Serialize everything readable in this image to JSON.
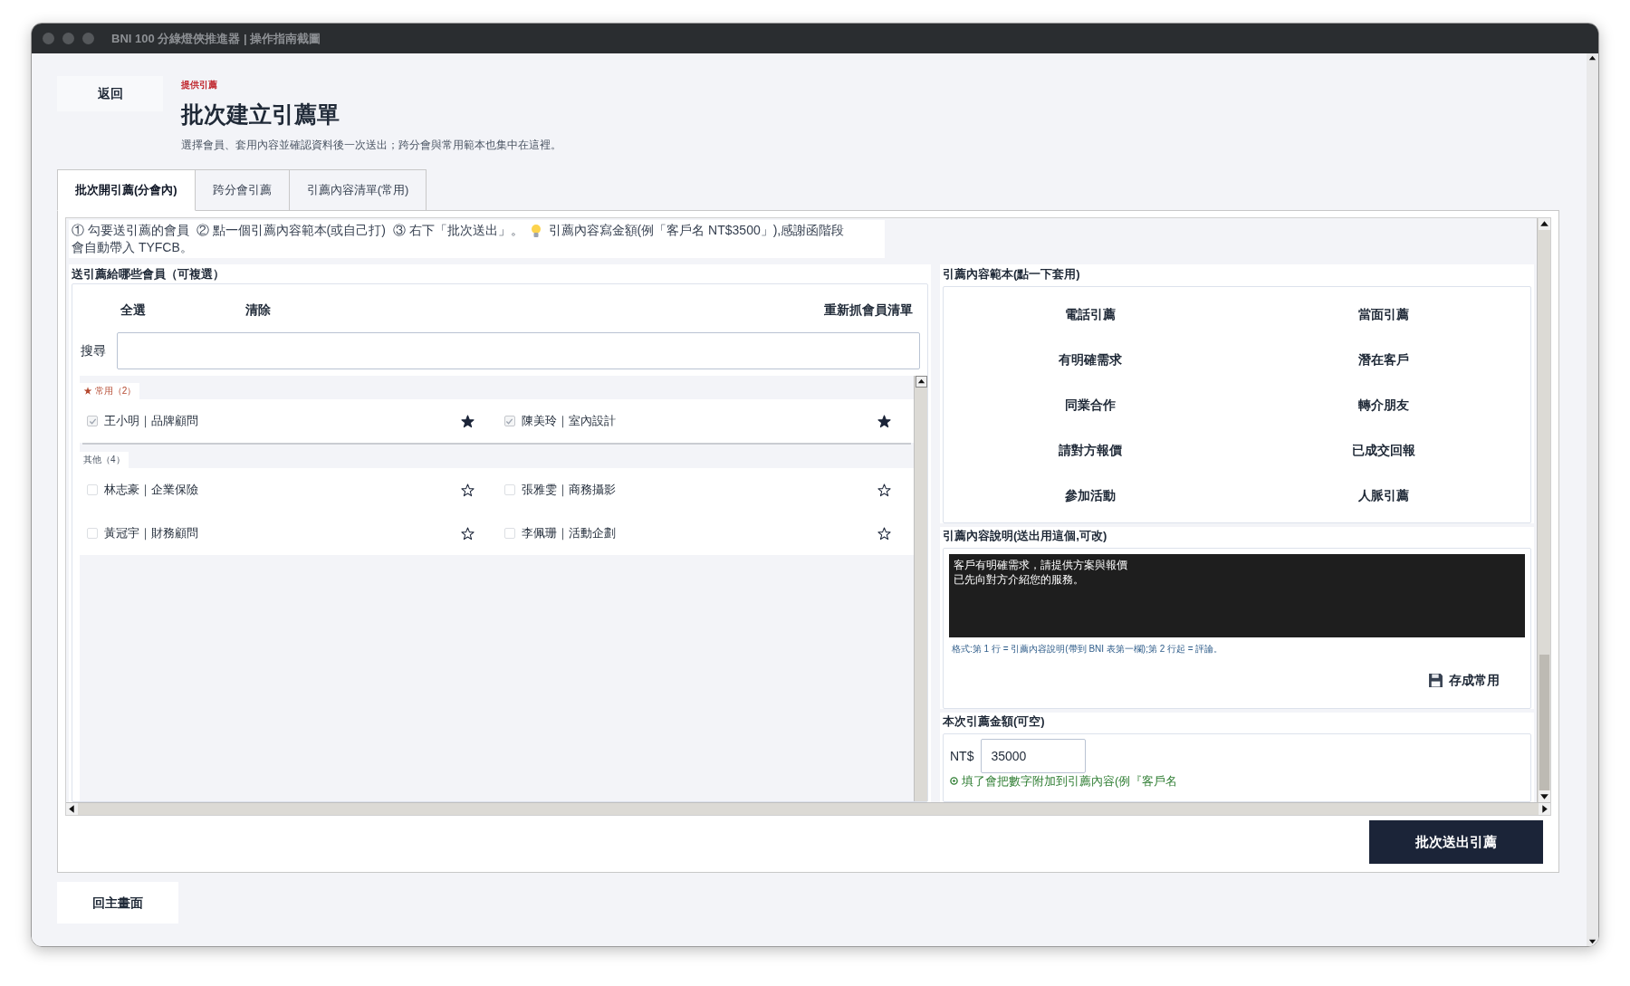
{
  "window": {
    "title": "BNI 100 分綠燈俠推進器 | 操作指南截圖"
  },
  "back_button": "返回",
  "header": {
    "eyebrow": "提供引薦",
    "title": "批次建立引薦單",
    "subtitle": "選擇會員、套用內容並確認資料後一次送出；跨分會與常用範本也集中在這裡。"
  },
  "tabs": [
    {
      "label": "批次開引薦(分會內)",
      "selected": true
    },
    {
      "label": "跨分會引薦",
      "selected": false
    },
    {
      "label": "引薦內容清單(常用)",
      "selected": false
    }
  ],
  "hint": {
    "steps": "① 勾要送引薦的會員  ② 點一個引薦內容範本(或自己打)  ③ 右下「批次送出」。",
    "tip_lines": [
      "引薦內容寫金額(例「客戶名 NT$3500」),感謝函階段",
      "會自動帶入 TYFCB。"
    ]
  },
  "members": {
    "label": "送引薦給哪些會員（可複選）",
    "actions": [
      "全選",
      "清除"
    ],
    "refresh_button": "重新抓會員清單",
    "search_label": "搜尋",
    "groups": [
      {
        "kind": "favorites",
        "label": "★ 常用（2）",
        "members": [
          {
            "name": "王小明｜品牌顧問",
            "checked": true,
            "favorite": true
          },
          {
            "name": "陳美玲｜室內設計",
            "checked": true,
            "favorite": true
          }
        ]
      },
      {
        "kind": "others",
        "label": "其他（4）",
        "members": [
          {
            "name": "林志豪｜企業保險",
            "checked": false,
            "favorite": false
          },
          {
            "name": "張雅雯｜商務攝影",
            "checked": false,
            "favorite": false
          },
          {
            "name": "黃冠宇｜財務顧問",
            "checked": false,
            "favorite": false
          },
          {
            "name": "李佩珊｜活動企劃",
            "checked": false,
            "favorite": false
          }
        ]
      }
    ]
  },
  "templates": {
    "label": "引薦內容範本(點一下套用)",
    "items": [
      "電話引薦",
      "當面引薦",
      "有明確需求",
      "潛在客戶",
      "同業合作",
      "轉介朋友",
      "請對方報價",
      "已成交回報",
      "參加活動",
      "人脈引薦"
    ]
  },
  "description": {
    "label": "引薦內容說明(送出用這個,可改)",
    "lines": [
      "客戶有明確需求，請提供方案與報價",
      "已先向對方介紹您的服務。"
    ],
    "note": "格式:第 1 行 = 引薦內容說明(帶到 BNI 表第一欄);第 2 行起 = 評論。",
    "save_button": "存成常用"
  },
  "amount": {
    "label": "本次引薦金額(可空)",
    "currency": "NT$",
    "value": "35000",
    "note": "填了會把數字附加到引薦內容(例『客戶名"
  },
  "submit_button": "批次送出引薦",
  "home_button": "回主畫面"
}
